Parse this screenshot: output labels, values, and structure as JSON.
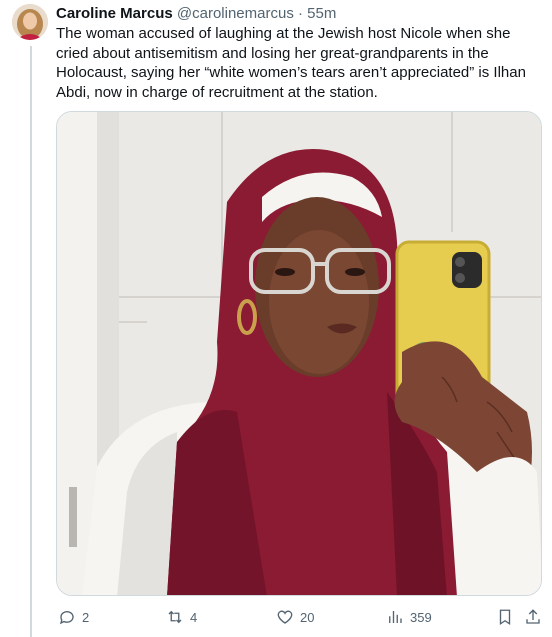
{
  "tweet": {
    "author_name": "Caroline Marcus",
    "handle": "@carolinemarcus",
    "separator": "·",
    "time": "55m",
    "text": "The woman accused of laughing at the Jewish host Nicole when she cried about antisemitism and losing her great-grandparents in the Holocaust, saying her “white women’s tears aren’t appreciated” is Ilhan Abdi, now in charge of recruitment at the station."
  },
  "actions": {
    "replies": "2",
    "reposts": "4",
    "likes": "20",
    "views": "359"
  },
  "colors": {
    "hijab": "#8b1a33",
    "tile": "#eae8e4",
    "phone_case": "#e6cd4f",
    "secondary_text": "#536471"
  }
}
